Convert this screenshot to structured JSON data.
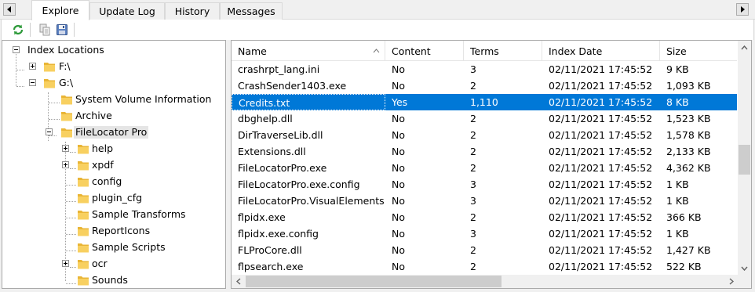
{
  "tabs": [
    {
      "label": "Explore",
      "active": true
    },
    {
      "label": "Update Log",
      "active": false
    },
    {
      "label": "History",
      "active": false
    },
    {
      "label": "Messages",
      "active": false
    }
  ],
  "toolbar": {
    "buttons": [
      "refresh-icon",
      "copy-icon",
      "save-icon"
    ]
  },
  "tree": {
    "root": "Index Locations",
    "drive_f": "F:\\",
    "drive_g": "G:\\",
    "svi": "System Volume Information",
    "archive": "Archive",
    "flp": "FileLocator Pro",
    "children": [
      "help",
      "xpdf",
      "config",
      "plugin_cfg",
      "Sample Transforms",
      "ReportIcons",
      "Sample Scripts",
      "ocr",
      "Sounds"
    ]
  },
  "list": {
    "columns": [
      "Name",
      "Content",
      "Terms",
      "Index Date",
      "Size"
    ],
    "rows": [
      [
        "crashrpt_lang.ini",
        "No",
        "3",
        "02/11/2021 17:45:52",
        "9 KB"
      ],
      [
        "CrashSender1403.exe",
        "No",
        "2",
        "02/11/2021 17:45:52",
        "1,093 KB"
      ],
      [
        "Credits.txt",
        "Yes",
        "1,110",
        "02/11/2021 17:45:52",
        "8 KB"
      ],
      [
        "dbghelp.dll",
        "No",
        "2",
        "02/11/2021 17:45:52",
        "1,523 KB"
      ],
      [
        "DirTraverseLib.dll",
        "No",
        "2",
        "02/11/2021 17:45:52",
        "1,578 KB"
      ],
      [
        "Extensions.dll",
        "No",
        "2",
        "02/11/2021 17:45:52",
        "2,133 KB"
      ],
      [
        "FileLocatorPro.exe",
        "No",
        "2",
        "02/11/2021 17:45:52",
        "4,362 KB"
      ],
      [
        "FileLocatorPro.exe.config",
        "No",
        "3",
        "02/11/2021 17:45:52",
        "1 KB"
      ],
      [
        "FileLocatorPro.VisualElements...",
        "No",
        "3",
        "02/11/2021 17:45:52",
        "1 KB"
      ],
      [
        "flpidx.exe",
        "No",
        "2",
        "02/11/2021 17:45:52",
        "366 KB"
      ],
      [
        "flpidx.exe.config",
        "No",
        "3",
        "02/11/2021 17:45:52",
        "1 KB"
      ],
      [
        "FLProCore.dll",
        "No",
        "2",
        "02/11/2021 17:45:52",
        "1,427 KB"
      ],
      [
        "flpsearch.exe",
        "No",
        "2",
        "02/11/2021 17:45:52",
        "522 KB"
      ]
    ],
    "selected_index": 2
  },
  "colors": {
    "selection": "#0078d7",
    "folder": "#f5c542"
  }
}
